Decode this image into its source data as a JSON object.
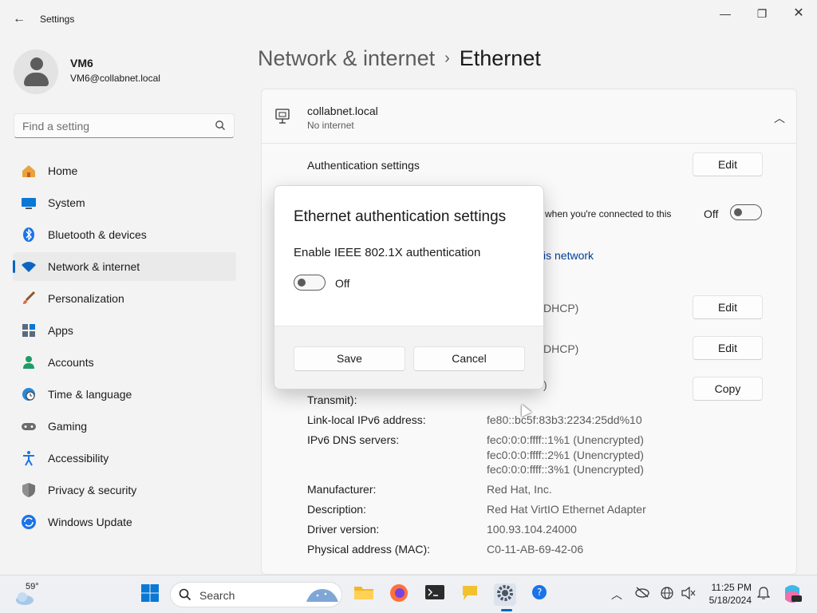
{
  "app": {
    "title": "Settings"
  },
  "user": {
    "name": "VM6",
    "email": "VM6@collabnet.local"
  },
  "search": {
    "placeholder": "Find a setting"
  },
  "sidebar": {
    "items": [
      {
        "label": "Home",
        "icon": "home-icon"
      },
      {
        "label": "System",
        "icon": "system-icon"
      },
      {
        "label": "Bluetooth & devices",
        "icon": "bluetooth-icon"
      },
      {
        "label": "Network & internet",
        "icon": "wifi-icon",
        "active": true
      },
      {
        "label": "Personalization",
        "icon": "brush-icon"
      },
      {
        "label": "Apps",
        "icon": "apps-icon"
      },
      {
        "label": "Accounts",
        "icon": "person-icon"
      },
      {
        "label": "Time & language",
        "icon": "globe-clock-icon"
      },
      {
        "label": "Gaming",
        "icon": "gamepad-icon"
      },
      {
        "label": "Accessibility",
        "icon": "accessibility-icon"
      },
      {
        "label": "Privacy & security",
        "icon": "shield-icon"
      },
      {
        "label": "Windows Update",
        "icon": "update-icon"
      }
    ]
  },
  "breadcrumb": {
    "parent": "Network & internet",
    "separator": "›",
    "current": "Ethernet"
  },
  "network": {
    "name": "collabnet.local",
    "status": "No internet"
  },
  "settings": {
    "auth_label": "Authentication settings",
    "edit": "Edit",
    "copy": "Copy",
    "metered_text": "e when you're connected to this",
    "metered_state": "Off",
    "data_usage_link": "is network",
    "ip_assign": "DHCP)",
    "dns_assign": "DHCP)",
    "link_speed_label": "Transmit):",
    "link_speed_value": ")",
    "ipv6_label": "Link-local IPv6 address:",
    "ipv6_value": "fe80::bc5f:83b3:2234:25dd%10",
    "dns_label": "IPv6 DNS servers:",
    "dns_values": [
      "fec0:0:0:ffff::1%1 (Unencrypted)",
      "fec0:0:0:ffff::2%1 (Unencrypted)",
      "fec0:0:0:ffff::3%1 (Unencrypted)"
    ],
    "manufacturer_label": "Manufacturer:",
    "manufacturer_value": "Red Hat, Inc.",
    "description_label": "Description:",
    "description_value": "Red Hat VirtIO Ethernet Adapter",
    "driver_label": "Driver version:",
    "driver_value": "100.93.104.24000",
    "mac_label": "Physical address (MAC):",
    "mac_value": "C0-11-AB-69-42-06"
  },
  "dialog": {
    "title": "Ethernet authentication settings",
    "toggle_label": "Enable IEEE 802.1X authentication",
    "toggle_state": "Off",
    "save": "Save",
    "cancel": "Cancel"
  },
  "taskbar": {
    "weather": "59°",
    "search_placeholder": "Search",
    "time": "11:25 PM",
    "date": "5/18/2024"
  },
  "colors": {
    "accent": "#0067c0",
    "background": "#f3f3f3",
    "panel": "#f9f9f9"
  }
}
